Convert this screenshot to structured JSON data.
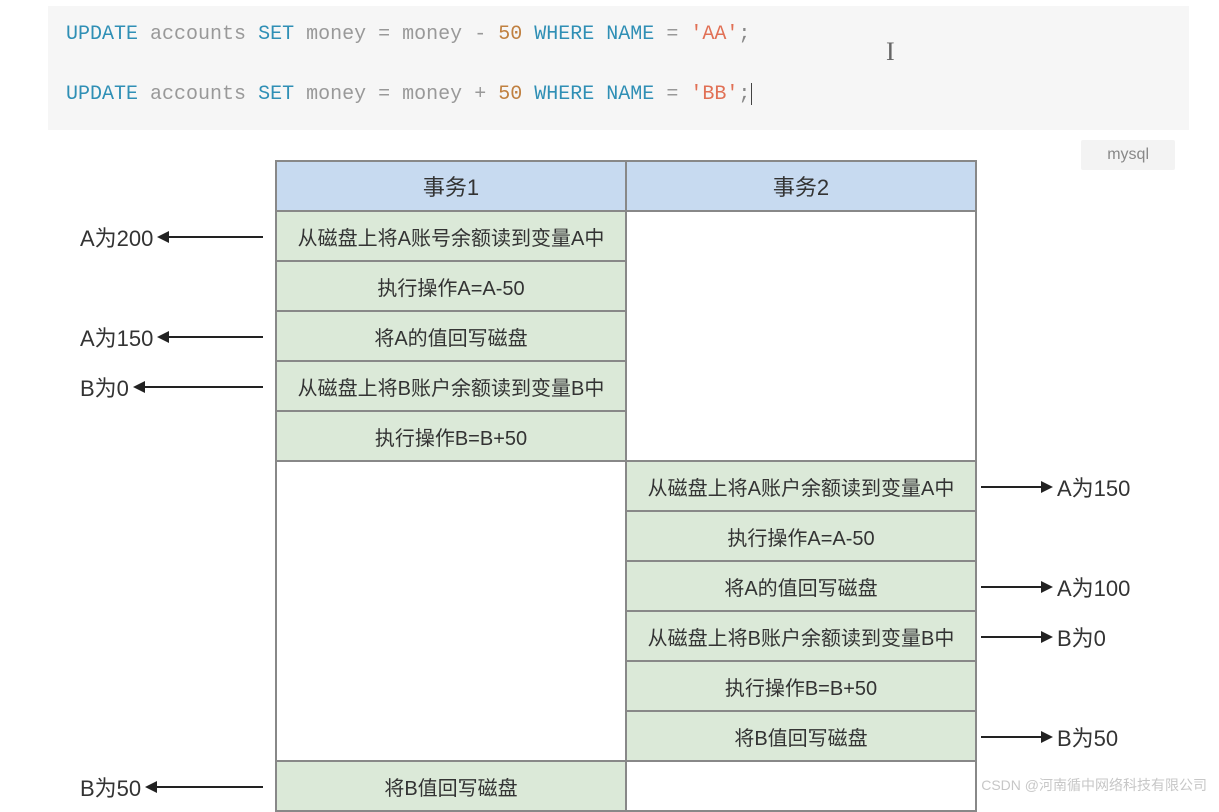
{
  "lang_tag": "mysql",
  "sql_tokens": {
    "update": "UPDATE",
    "accounts": "accounts",
    "set": "SET",
    "money": "money",
    "eq": "=",
    "minus": "-",
    "plus": "+",
    "amt": "50",
    "where": "WHERE",
    "name": "NAME",
    "aa": "'AA'",
    "bb": "'BB'",
    "semi": ";"
  },
  "table": {
    "headers": [
      "事务1",
      "事务2"
    ],
    "rows": [
      {
        "t1": "从磁盘上将A账号余额读到变量A中",
        "t2": ""
      },
      {
        "t1": "执行操作A=A-50",
        "t2": ""
      },
      {
        "t1": "将A的值回写磁盘",
        "t2": ""
      },
      {
        "t1": "从磁盘上将B账户余额读到变量B中",
        "t2": ""
      },
      {
        "t1": "执行操作B=B+50",
        "t2": ""
      },
      {
        "t1": "",
        "t2": "从磁盘上将A账户余额读到变量A中"
      },
      {
        "t1": "",
        "t2": "执行操作A=A-50"
      },
      {
        "t1": "",
        "t2": "将A的值回写磁盘"
      },
      {
        "t1": "",
        "t2": "从磁盘上将B账户余额读到变量B中"
      },
      {
        "t1": "",
        "t2": "执行操作B=B+50"
      },
      {
        "t1": "",
        "t2": "将B值回写磁盘"
      },
      {
        "t1": "将B值回写磁盘",
        "t2": ""
      }
    ]
  },
  "annotations": {
    "left": [
      {
        "row": 0,
        "text": "A为200"
      },
      {
        "row": 2,
        "text": "A为150"
      },
      {
        "row": 3,
        "text": "B为0"
      },
      {
        "row": 11,
        "text": "B为50"
      }
    ],
    "right": [
      {
        "row": 5,
        "text": "A为150"
      },
      {
        "row": 7,
        "text": "A为100"
      },
      {
        "row": 8,
        "text": "B为0"
      },
      {
        "row": 10,
        "text": "B为50"
      }
    ]
  },
  "watermark": "CSDN @河南循中网络科技有限公司"
}
